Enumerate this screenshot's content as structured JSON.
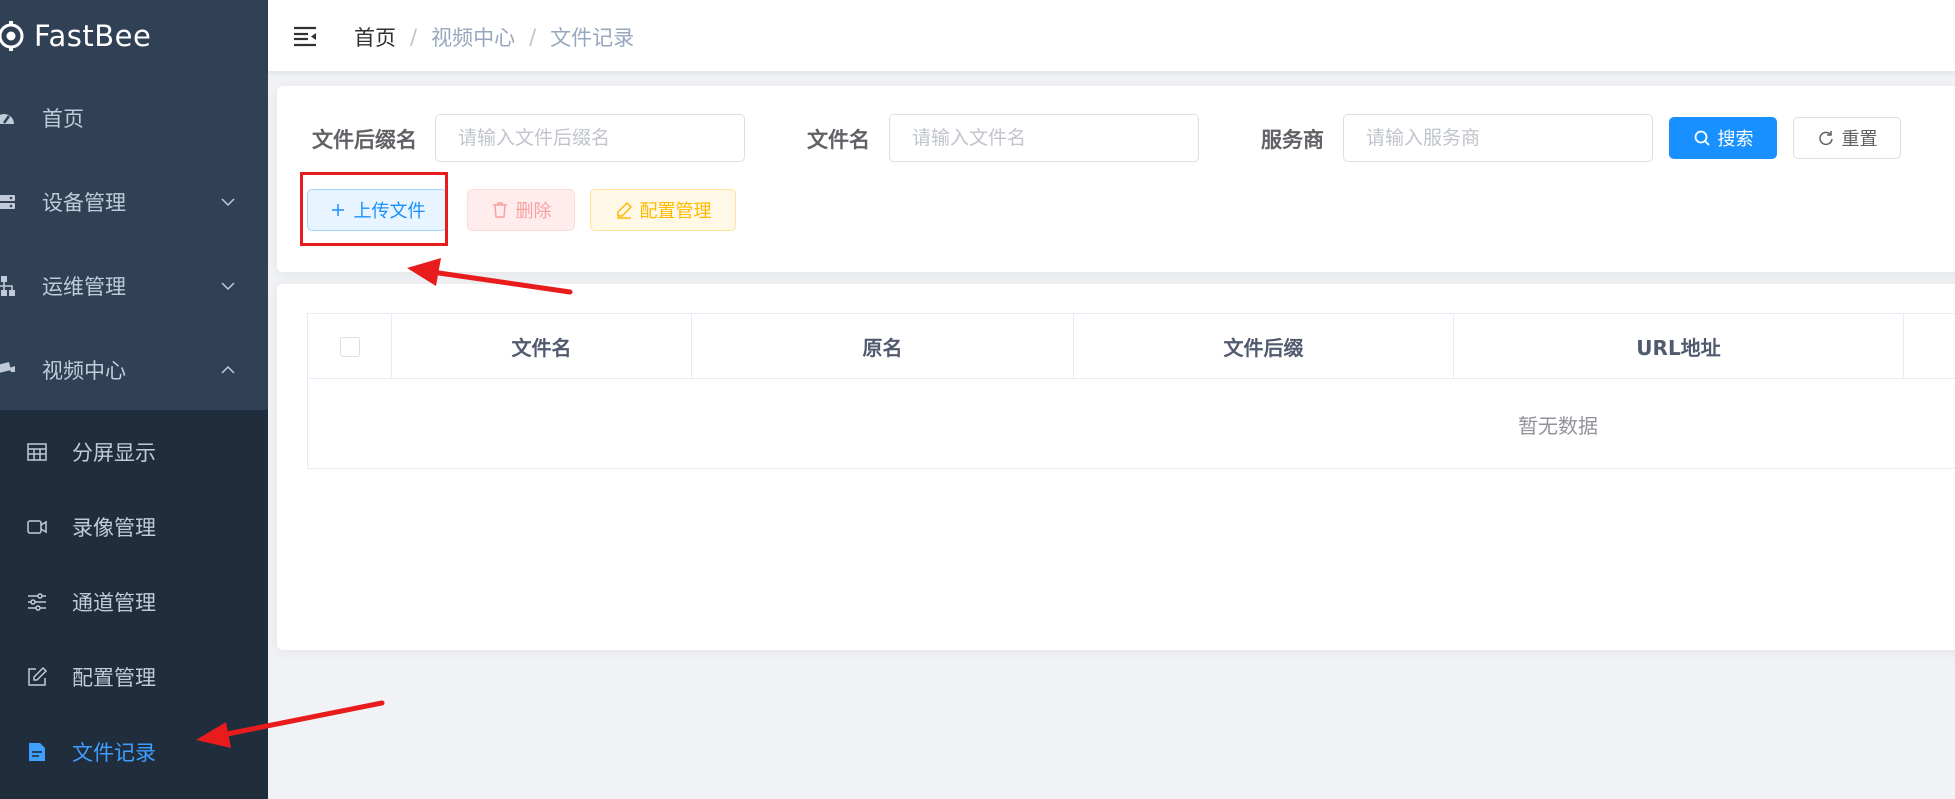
{
  "app": {
    "logo_text": "FastBee"
  },
  "sidebar": {
    "menu": [
      {
        "label": "首页",
        "icon": "dashboard-icon"
      },
      {
        "label": "设备管理",
        "icon": "server-icon"
      },
      {
        "label": "运维管理",
        "icon": "tree-structure-icon"
      },
      {
        "label": "视频中心",
        "icon": "camera-icon"
      }
    ],
    "video_submenu": [
      {
        "label": "分屏显示",
        "icon": "table-icon"
      },
      {
        "label": "录像管理",
        "icon": "video-icon"
      },
      {
        "label": "通道管理",
        "icon": "sliders-icon"
      },
      {
        "label": "配置管理",
        "icon": "edit-icon"
      },
      {
        "label": "文件记录",
        "icon": "document-icon",
        "active": true
      }
    ]
  },
  "breadcrumb": {
    "home": "首页",
    "section": "视频中心",
    "current": "文件记录"
  },
  "search": {
    "suffix_label": "文件后缀名",
    "suffix_placeholder": "请输入文件后缀名",
    "suffix_value": "",
    "filename_label": "文件名",
    "filename_placeholder": "请输入文件名",
    "filename_value": "",
    "provider_label": "服务商",
    "provider_placeholder": "请输入服务商",
    "provider_value": "",
    "search_button": "搜索",
    "reset_button": "重置"
  },
  "toolbar": {
    "upload_button": "上传文件",
    "delete_button": "删除",
    "config_button": "配置管理"
  },
  "table": {
    "columns": [
      "文件名",
      "原名",
      "文件后缀",
      "URL地址"
    ],
    "empty_text": "暂无数据"
  },
  "colors": {
    "sidebar_bg": "#304156",
    "submenu_bg": "#1f2d3d",
    "primary": "#1890ff",
    "active_menu": "#409eff",
    "annotation_red": "#e81c1c"
  }
}
